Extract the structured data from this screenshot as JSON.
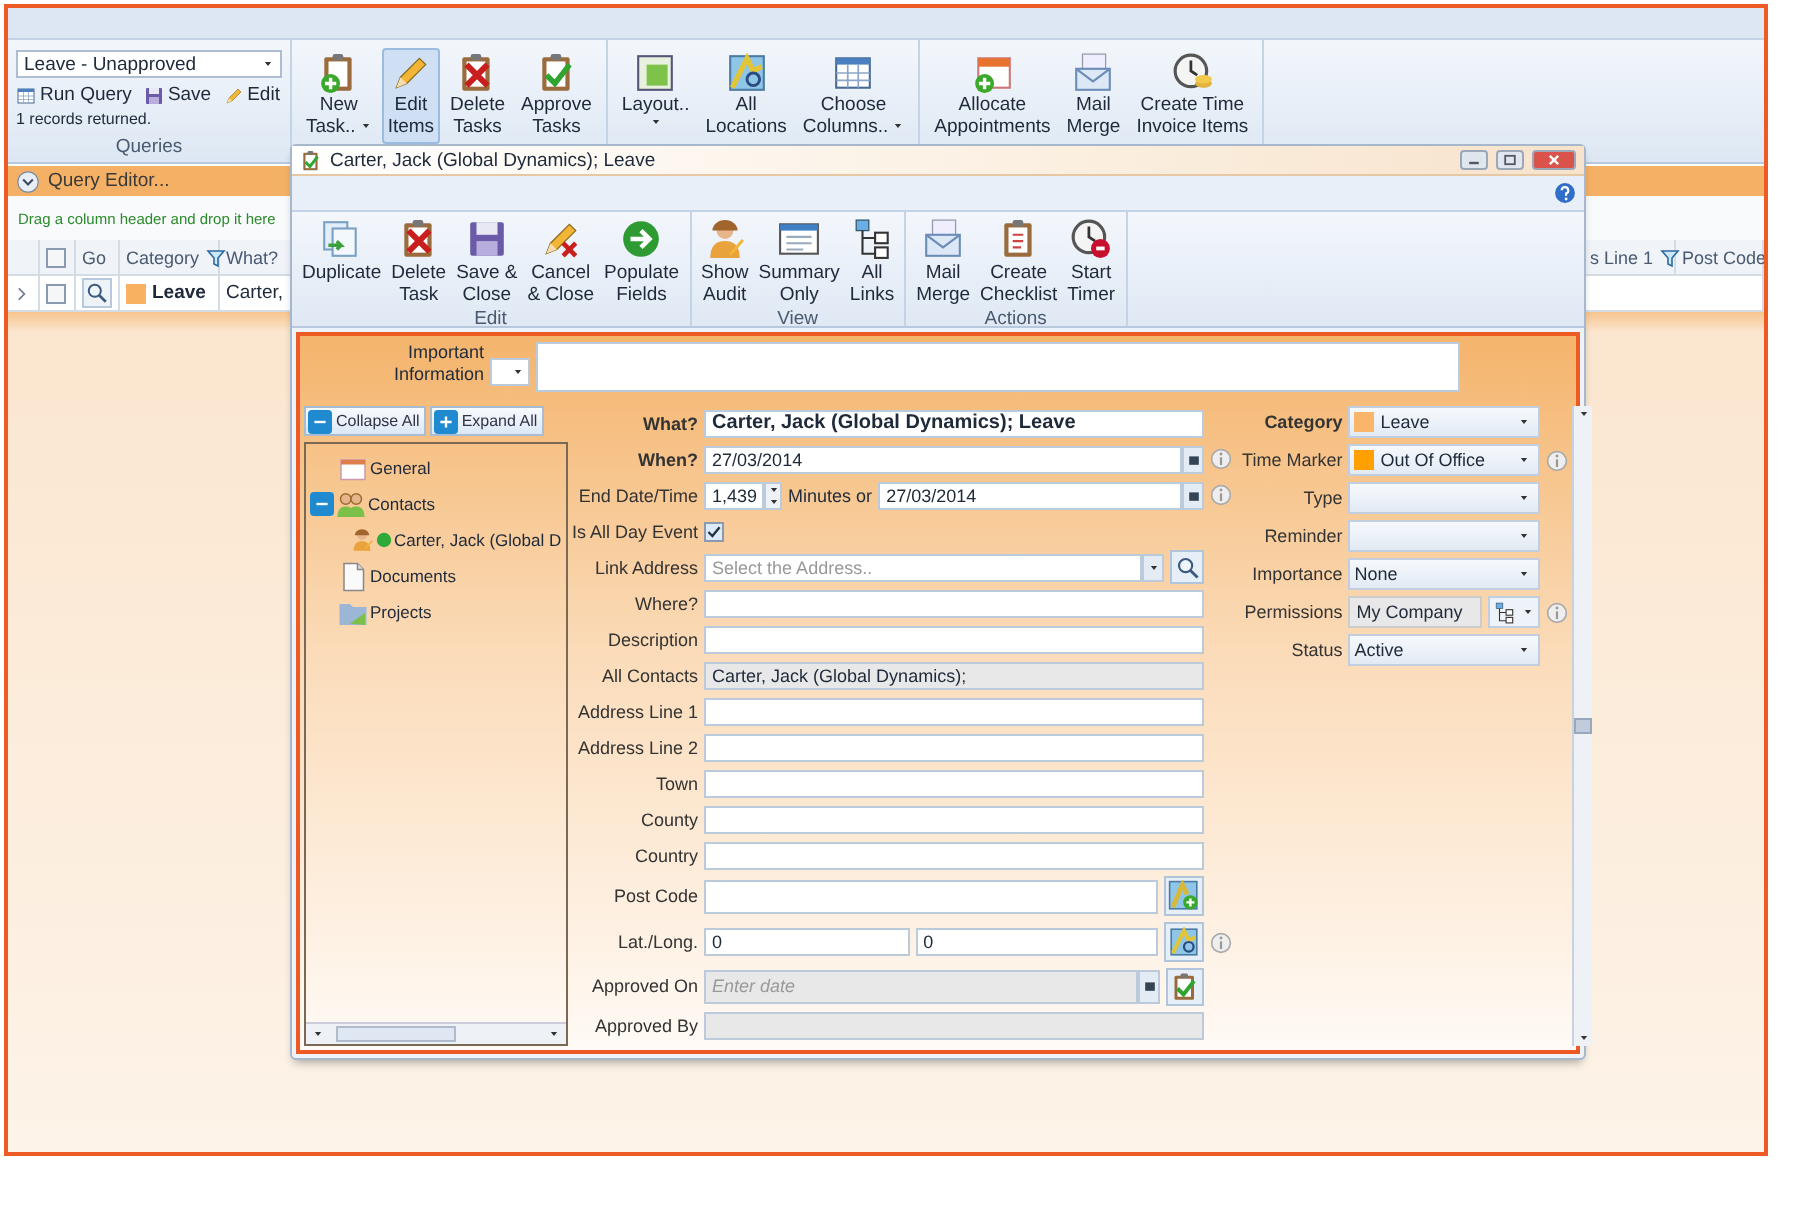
{
  "app": {
    "query": {
      "value": "Leave - Unapproved",
      "actions": [
        "Run Query",
        "Save",
        "Edit"
      ],
      "records": "1 records returned.",
      "group": "Queries"
    },
    "ribbon": [
      {
        "buttons": [
          {
            "label": "New Task..",
            "dropdown": true,
            "selected": false
          },
          {
            "label": "Edit Items",
            "dropdown": false,
            "selected": true
          },
          {
            "label": "Delete Tasks",
            "dropdown": false,
            "selected": false
          },
          {
            "label": "Approve Tasks",
            "dropdown": false,
            "selected": false
          }
        ]
      },
      {
        "buttons": [
          {
            "label": "Layout..",
            "dropdown": true,
            "selected": false
          },
          {
            "label": "All Locations",
            "dropdown": false,
            "selected": false
          },
          {
            "label": "Choose Columns..",
            "dropdown": true,
            "selected": false
          }
        ]
      },
      {
        "buttons": [
          {
            "label": "Allocate Appointments",
            "dropdown": false,
            "selected": false
          },
          {
            "label": "Mail Merge",
            "dropdown": false,
            "selected": false
          },
          {
            "label": "Create Time Invoice Items",
            "dropdown": false,
            "selected": false
          }
        ]
      }
    ],
    "query_editor": "Query Editor...",
    "group_hint": "Drag a column header and drop it here",
    "grid": {
      "select_all": false,
      "columns": [
        {
          "label": "Go"
        },
        {
          "label": "Category",
          "filter": true
        },
        {
          "label": "What?"
        },
        {
          "label": "s Line 1",
          "filter": true
        },
        {
          "label": "Post Code"
        }
      ],
      "rows": [
        {
          "checked": false,
          "category": "Leave",
          "what": "Carter,"
        }
      ]
    }
  },
  "dialog": {
    "title": "Carter, Jack (Global Dynamics); Leave",
    "toolbar": [
      {
        "label": "Edit",
        "buttons": [
          "Duplicate",
          "Delete Task",
          "Save & Close",
          "Cancel & Close",
          "Populate Fields"
        ]
      },
      {
        "label": "View",
        "buttons": [
          "Show Audit",
          "Summary Only",
          "All Links"
        ]
      },
      {
        "label": "Actions",
        "buttons": [
          "Mail Merge",
          "Create Checklist",
          "Start Timer"
        ]
      }
    ],
    "form": {
      "important": {
        "label": "Important Information"
      },
      "tree": {
        "collapse": "Collapse All",
        "expand": "Expand All",
        "items": [
          {
            "label": "General"
          },
          {
            "label": "Contacts",
            "expanded": true,
            "children": [
              {
                "label": "Carter, Jack (Global D"
              }
            ]
          },
          {
            "label": "Documents"
          },
          {
            "label": "Projects"
          }
        ]
      },
      "fields": [
        {
          "label": "What?",
          "bold": true,
          "kind": "title",
          "value": "Carter, Jack (Global Dynamics); Leave"
        },
        {
          "label": "When?",
          "bold": true,
          "kind": "date",
          "value": "27/03/2014",
          "info": true
        },
        {
          "label": "End Date/Time",
          "kind": "duration",
          "minutes": "1,439",
          "joiner": "Minutes or",
          "value": "27/03/2014",
          "info": true
        },
        {
          "label": "Is All Day Event",
          "kind": "checkbox",
          "checked": true
        },
        {
          "label": "Link Address",
          "kind": "address",
          "placeholder": "Select the Address.."
        },
        {
          "label": "Where?",
          "kind": "text"
        },
        {
          "label": "Description",
          "kind": "text"
        },
        {
          "label": "All Contacts",
          "kind": "readonly",
          "value": "Carter, Jack (Global Dynamics);"
        },
        {
          "label": "Address Line 1",
          "kind": "text"
        },
        {
          "label": "Address Line 2",
          "kind": "text"
        },
        {
          "label": "Town",
          "kind": "text"
        },
        {
          "label": "County",
          "kind": "text"
        },
        {
          "label": "Country",
          "kind": "text"
        },
        {
          "label": "Post Code",
          "kind": "postcode"
        },
        {
          "label": "Lat./Long.",
          "kind": "latlong",
          "values": [
            "0",
            "0"
          ],
          "info": true
        },
        {
          "label": "Approved On",
          "kind": "approval",
          "placeholder": "Enter date"
        },
        {
          "label": "Approved By",
          "kind": "readonly"
        }
      ],
      "side_fields": [
        {
          "label": "Category",
          "bold": true,
          "kind": "select",
          "value": "Leave",
          "color": "#f9b66b"
        },
        {
          "label": "Time Marker",
          "kind": "select",
          "value": "Out Of Office",
          "color": "#ff9f00",
          "info": true
        },
        {
          "label": "Type",
          "kind": "select"
        },
        {
          "label": "Reminder",
          "kind": "select"
        },
        {
          "label": "Importance",
          "kind": "select",
          "value": "None"
        },
        {
          "label": "Permissions",
          "kind": "permission",
          "value": "My Company",
          "info": true
        },
        {
          "label": "Status",
          "kind": "select",
          "value": "Active"
        }
      ]
    }
  }
}
